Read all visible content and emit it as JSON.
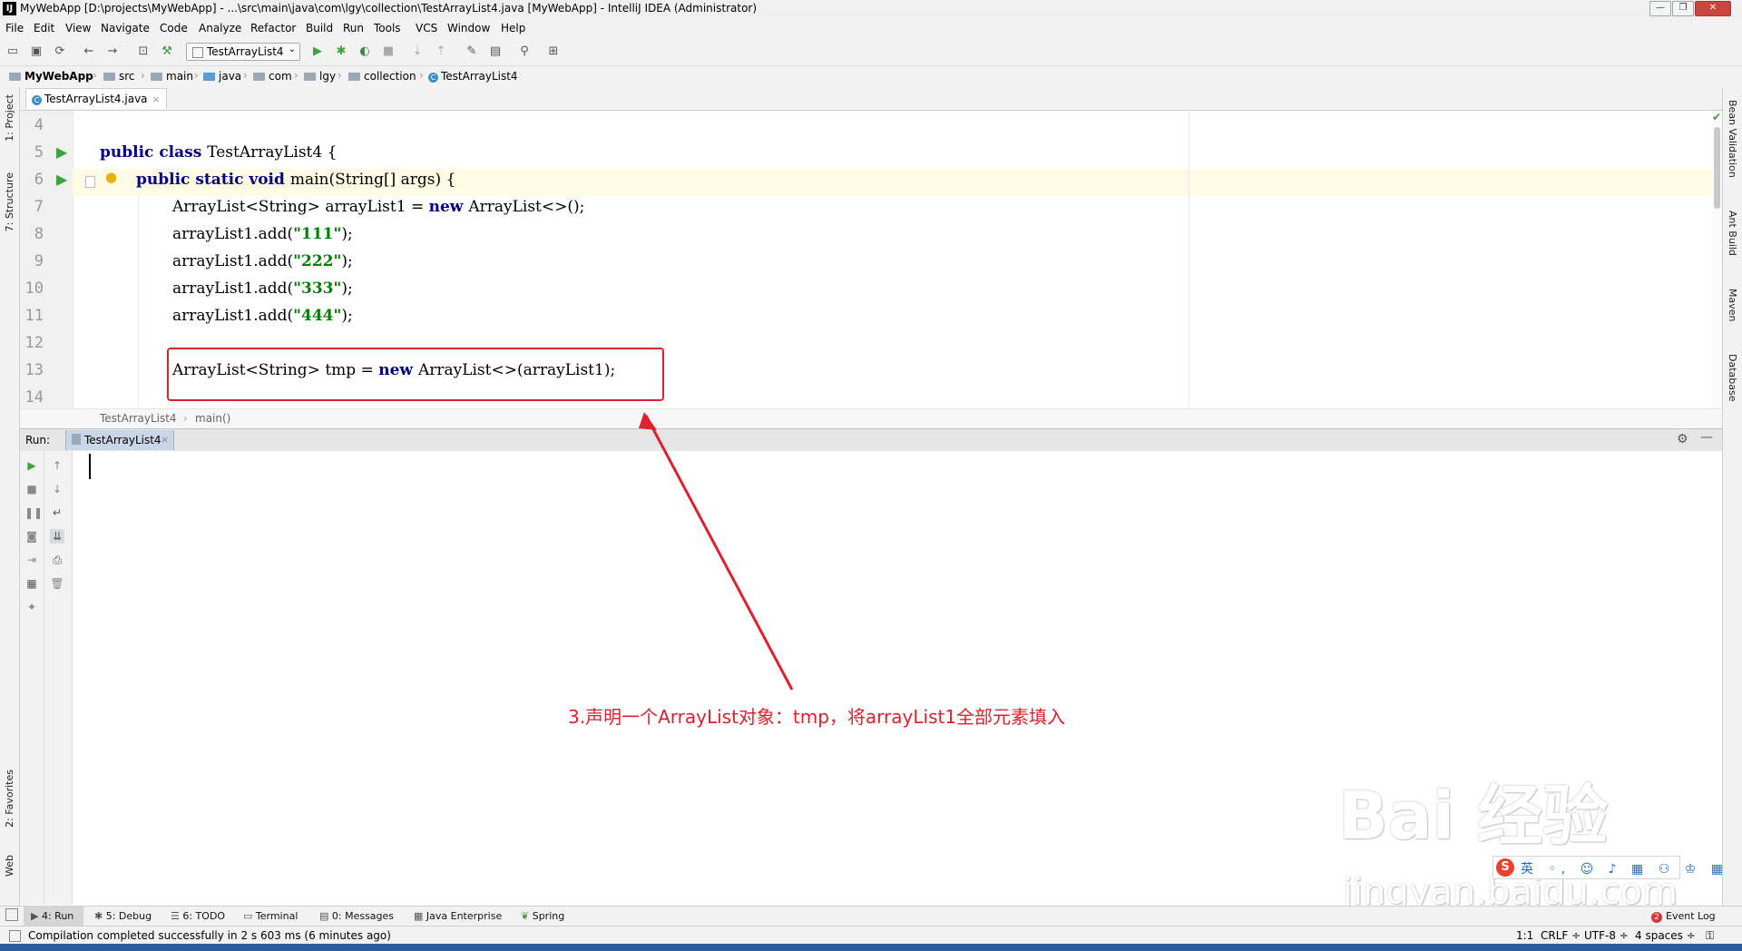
{
  "window": {
    "title": "MyWebApp [D:\\projects\\MyWebApp] - ...\\src\\main\\java\\com\\lgy\\collection\\TestArrayList4.java [MyWebApp] - IntelliJ IDEA (Administrator)",
    "icon": "IJ"
  },
  "menu": [
    "File",
    "Edit",
    "View",
    "Navigate",
    "Code",
    "Analyze",
    "Refactor",
    "Build",
    "Run",
    "Tools",
    "VCS",
    "Window",
    "Help"
  ],
  "toolbar": {
    "run_config": "TestArrayList4"
  },
  "breadcrumbs": [
    "MyWebApp",
    "src",
    "main",
    "java",
    "com",
    "lgy",
    "collection",
    "TestArrayList4"
  ],
  "left_tabs": {
    "project": "1: Project",
    "structure": "7: Structure",
    "favorites": "2: Favorites",
    "web": "Web"
  },
  "right_tabs": {
    "bean": "Bean Validation",
    "ant": "Ant Build",
    "maven": "Maven",
    "database": "Database"
  },
  "editor": {
    "tab": "TestArrayList4.java",
    "lines": [
      {
        "num": "4",
        "code": ""
      },
      {
        "num": "5",
        "kw": "public class ",
        "code": "TestArrayList4 {"
      },
      {
        "num": "6",
        "kw": "public static void ",
        "code": "main(String[] args) {"
      },
      {
        "num": "7",
        "code": "ArrayList<String> arrayList1 = ",
        "kw2": "new ",
        "code2": "ArrayList<>();"
      },
      {
        "num": "8",
        "code": "arrayList1.add(",
        "str": "\"111\"",
        "code2": ");"
      },
      {
        "num": "9",
        "code": "arrayList1.add(",
        "str": "\"222\"",
        "code2": ");"
      },
      {
        "num": "10",
        "code": "arrayList1.add(",
        "str": "\"333\"",
        "code2": ");"
      },
      {
        "num": "11",
        "code": "arrayList1.add(",
        "str": "\"444\"",
        "code2": ");"
      },
      {
        "num": "12",
        "code": ""
      },
      {
        "num": "13",
        "code": "ArrayList<String> tmp = ",
        "kw2": "new ",
        "code2": "ArrayList<>(arrayList1);"
      },
      {
        "num": "14",
        "code": ""
      }
    ],
    "crumbs": [
      "TestArrayList4",
      "main()"
    ]
  },
  "run_panel": {
    "label": "Run:",
    "tab": "TestArrayList4"
  },
  "annotation": "3.声明一个ArrayList对象：tmp，将arrayList1全部元素填入",
  "watermark": {
    "main": "Bai 经验",
    "sub": "jingyan.baidu.com"
  },
  "ime": {
    "logo": "S",
    "text": "英 ◦, ☺ ♪ ▦ ⚇ ♔ ▦"
  },
  "bottom_tabs": [
    "4: Run",
    "5: Debug",
    "6: TODO",
    "Terminal",
    "0: Messages",
    "Java Enterprise",
    "Spring"
  ],
  "event_log": "Event Log",
  "event_count": "2",
  "status": {
    "message": "Compilation completed successfully in 2 s 603 ms (6 minutes ago)",
    "position": "1:1",
    "line_sep": "CRLF ÷",
    "encoding": "UTF-8 ÷",
    "indent": "4 spaces ÷"
  },
  "colors": {
    "accent_red": "#e0202c",
    "keyword": "#000080",
    "string": "#008000"
  }
}
